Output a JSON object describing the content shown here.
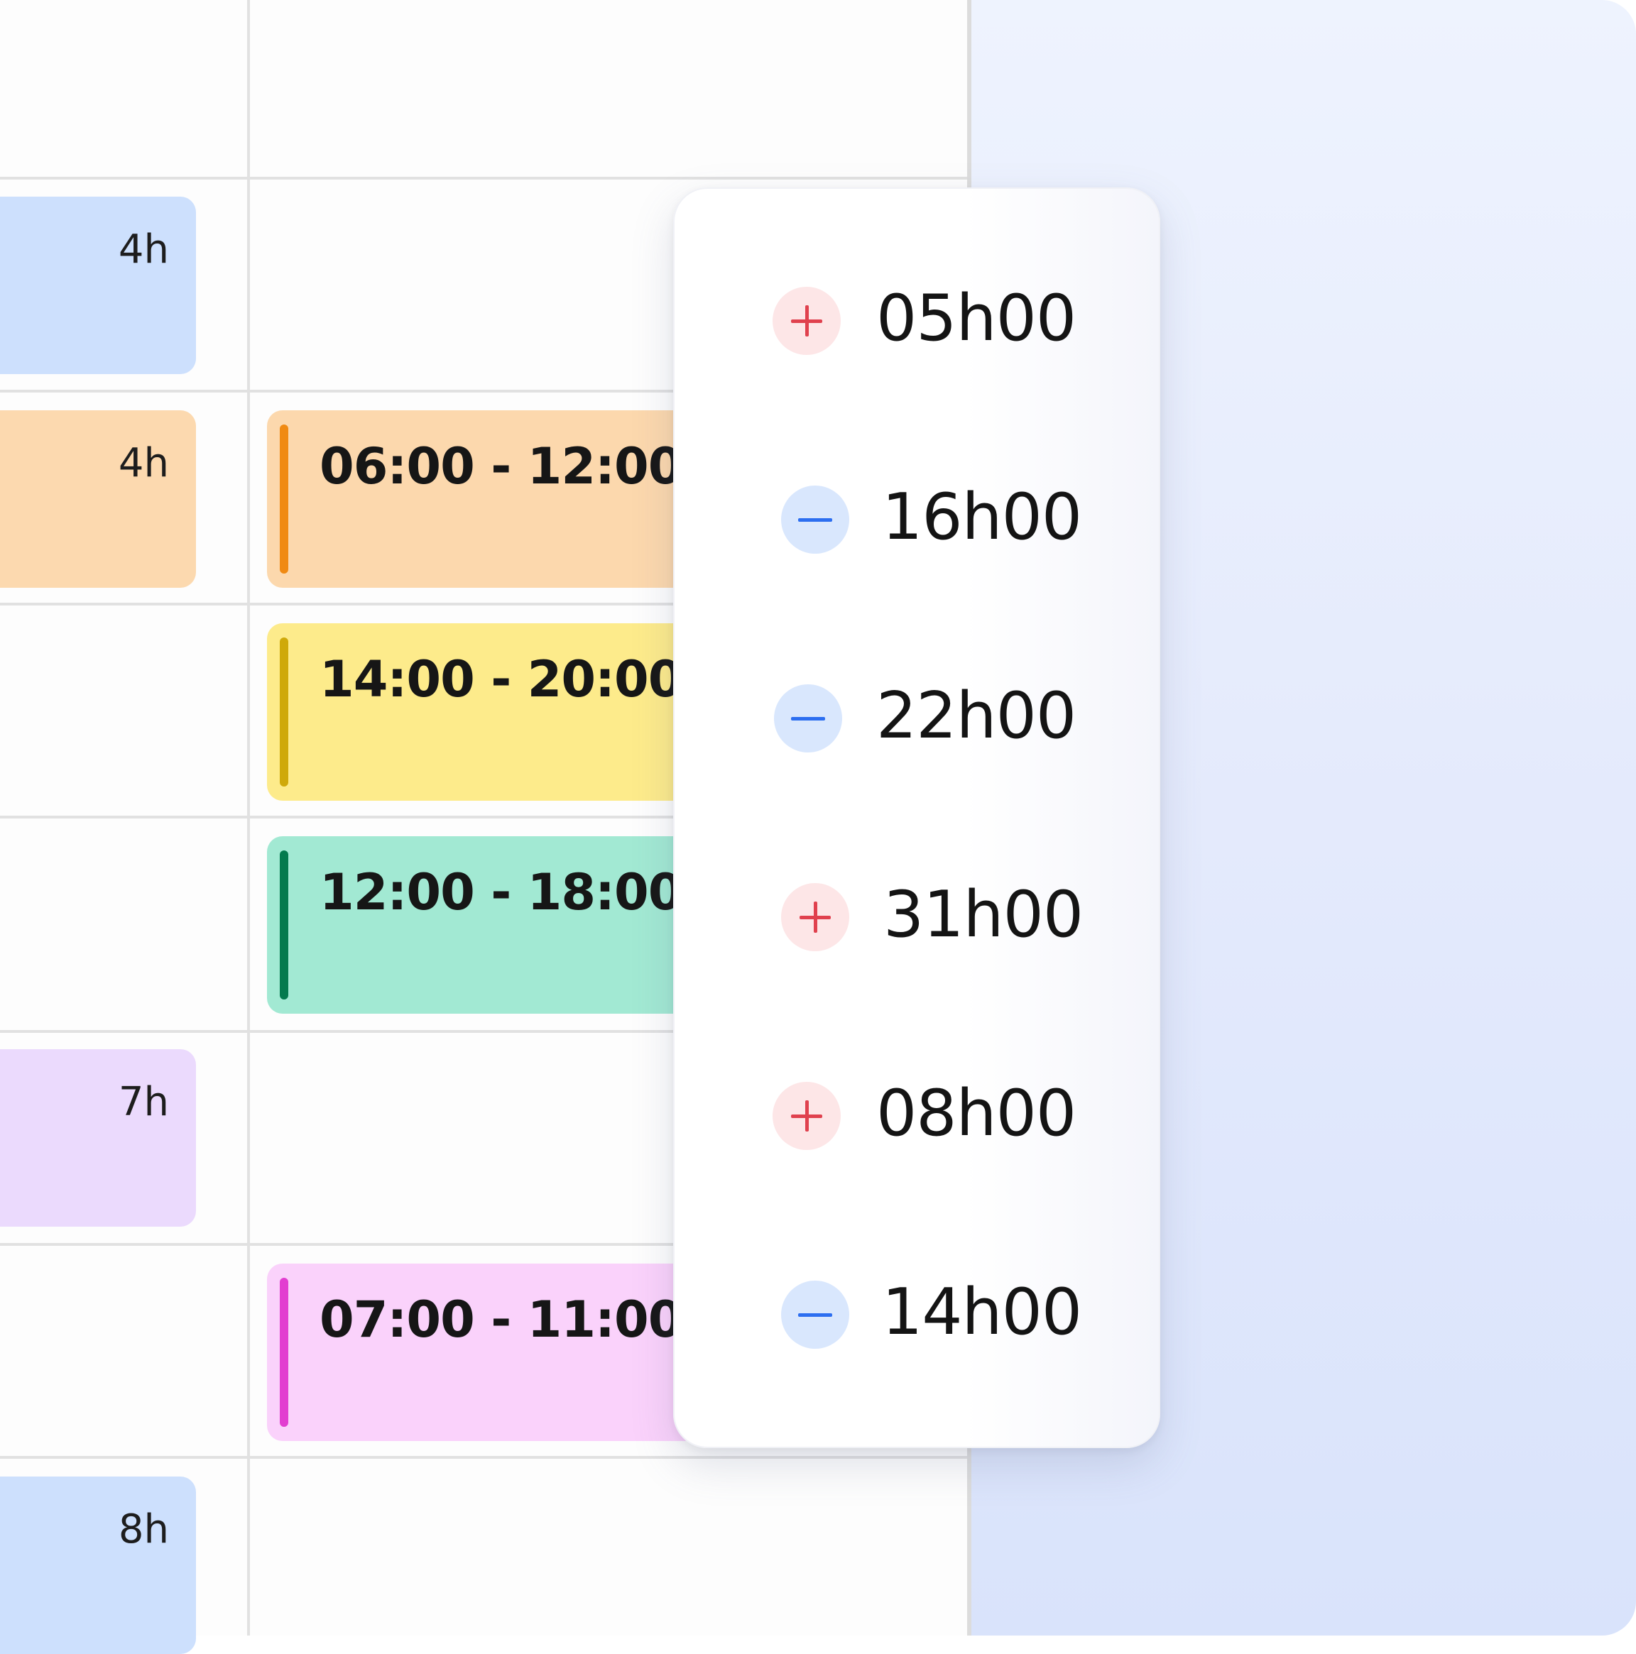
{
  "colors": {
    "blue_block": "#cde0fd",
    "orange_block": "#fcd9af",
    "purple_block": "#ebdafd",
    "orange_shift": "#fcd8ad",
    "orange_bar": "#f08a13",
    "yellow_shift": "#fdeb8b",
    "yellow_bar": "#cfa90a",
    "green_shift": "#a2e9d3",
    "green_bar": "#047a4e",
    "pink_shift": "#fad2fb",
    "pink_bar": "#e23ed0",
    "plus_bg": "#fde6e7",
    "plus_fg": "#e0414e",
    "minus_bg": "#d9e7fd",
    "minus_fg": "#2c6ef0"
  },
  "hour_blocks": [
    {
      "hours": "4h"
    },
    {
      "hours": "4h"
    },
    {
      "hours": "7h"
    },
    {
      "hours": "8h"
    }
  ],
  "shifts": [
    {
      "time": "06:00 - 12:00"
    },
    {
      "time": "14:00 - 20:00"
    },
    {
      "time": "12:00 - 18:00"
    },
    {
      "time": "07:00 - 11:00"
    }
  ],
  "balance_list": [
    {
      "sign": "plus",
      "icon": "plus-icon",
      "value": "05h00"
    },
    {
      "sign": "minus",
      "icon": "minus-icon",
      "value": "16h00"
    },
    {
      "sign": "minus",
      "icon": "minus-icon",
      "value": "22h00"
    },
    {
      "sign": "plus",
      "icon": "plus-icon",
      "value": "31h00"
    },
    {
      "sign": "plus",
      "icon": "plus-icon",
      "value": "08h00"
    },
    {
      "sign": "minus",
      "icon": "minus-icon",
      "value": "14h00"
    }
  ]
}
